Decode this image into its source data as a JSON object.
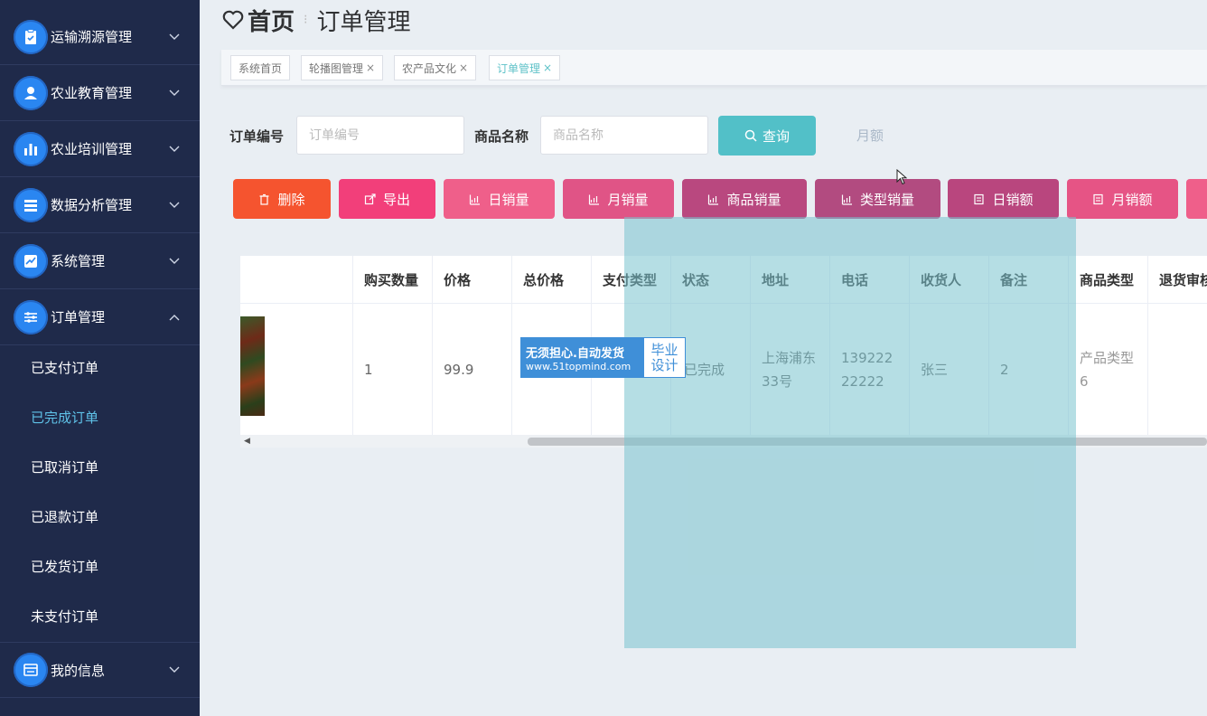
{
  "sidebar": {
    "menus": [
      {
        "label": "运输溯源管理",
        "icon": "clipboard-icon"
      },
      {
        "label": "农业教育管理",
        "icon": "user-icon"
      },
      {
        "label": "农业培训管理",
        "icon": "bar-chart-icon"
      },
      {
        "label": "数据分析管理",
        "icon": "list-icon"
      },
      {
        "label": "系统管理",
        "icon": "line-chart-icon"
      },
      {
        "label": "订单管理",
        "icon": "sliders-icon"
      }
    ],
    "submenu": [
      "已支付订单",
      "已完成订单",
      "已取消订单",
      "已退款订单",
      "已发货订单",
      "未支付订单"
    ],
    "active_submenu": "已完成订单",
    "last_menu": {
      "label": "我的信息",
      "icon": "card-icon"
    }
  },
  "header": {
    "home": "首页",
    "current": "订单管理"
  },
  "tabs": [
    {
      "label": "系统首页",
      "closable": false
    },
    {
      "label": "轮播图管理",
      "closable": true
    },
    {
      "label": "农产品文化",
      "closable": true
    },
    {
      "label": "订单管理",
      "closable": true,
      "active": true
    }
  ],
  "tab_close_glyph": "×",
  "search": {
    "order_no_label": "订单编号",
    "order_no_placeholder": "订单编号",
    "product_name_label": "商品名称",
    "product_name_placeholder": "商品名称",
    "query_label": "查询",
    "ghost_text": "月额"
  },
  "actions": [
    {
      "label": "删除",
      "color": "#f5542f",
      "icon": "trash-icon"
    },
    {
      "label": "导出",
      "color": "#f23f7a",
      "icon": "export-icon"
    },
    {
      "label": "日销量",
      "color": "#ef5f8a",
      "icon": "chart-icon"
    },
    {
      "label": "月销量",
      "color": "#e05486",
      "icon": "chart-icon"
    },
    {
      "label": "商品销量",
      "color": "#b9487f",
      "icon": "chart-icon"
    },
    {
      "label": "类型销量",
      "color": "#b24b80",
      "icon": "chart-icon"
    },
    {
      "label": "日销额",
      "color": "#b9467e",
      "icon": "doc-icon"
    },
    {
      "label": "月销额",
      "color": "#e65485",
      "icon": "doc-icon"
    }
  ],
  "table": {
    "headers": [
      "",
      "购买数量",
      "价格",
      "总价格",
      "支付类型",
      "状态",
      "地址",
      "电话",
      "收货人",
      "备注",
      "商品类型",
      "退货审核"
    ],
    "row": [
      "",
      "1",
      "99.9",
      "",
      "",
      "已完成",
      "上海浦东33号",
      "13922222222",
      "张三",
      "2",
      "产品类型6",
      ""
    ]
  },
  "watermark": {
    "line1": "无须担心.自动发货",
    "line2": "www.51topmind.com",
    "right1": "毕业",
    "right2": "设计"
  }
}
